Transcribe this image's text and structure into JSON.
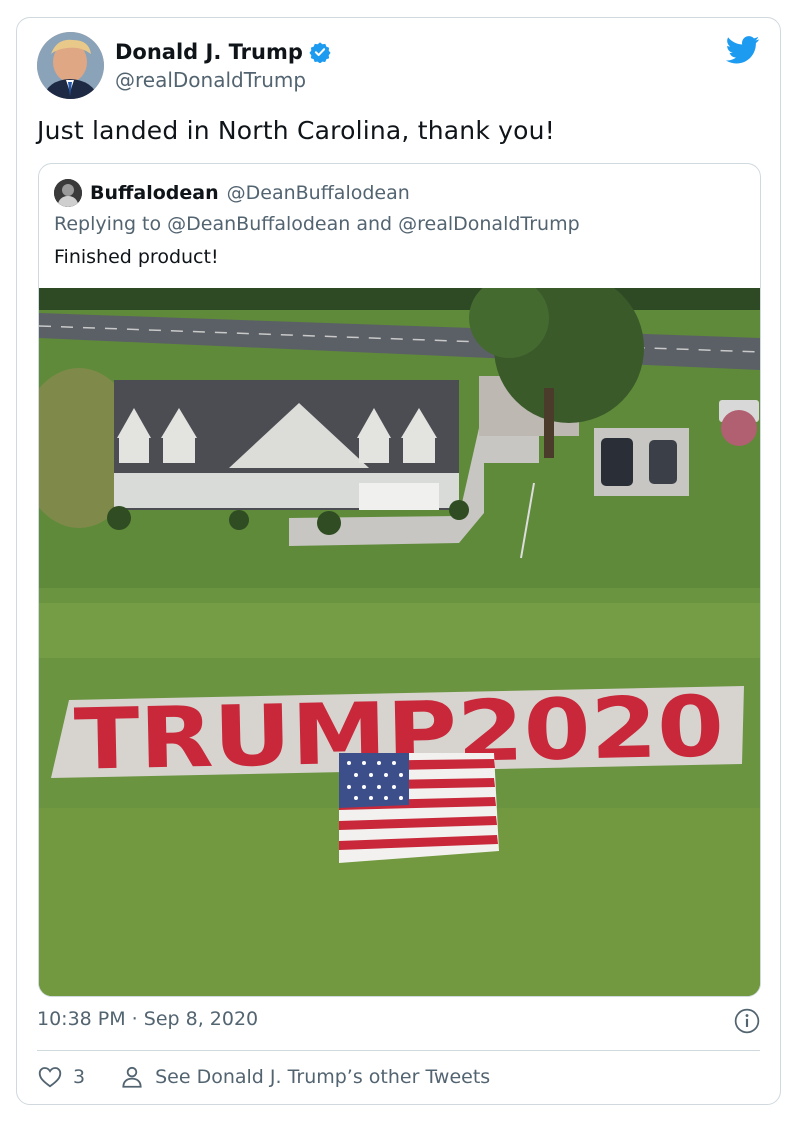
{
  "author": {
    "name": "Donald J. Trump",
    "handle": "@realDonaldTrump",
    "verified": true
  },
  "tweet_text": "Just landed in North Carolina, thank you!",
  "quoted_tweet": {
    "author_name": "Buffalodean",
    "author_handle": "@DeanBuffalodean",
    "reply_line": "Replying to @DeanBuffalodean and @realDonaldTrump",
    "text": "Finished product!",
    "photo": {
      "sign_text": "TRUMP2020",
      "description_icon": "aerial-house-photo"
    }
  },
  "timestamp": "10:38 PM · Sep 8, 2020",
  "actions": {
    "like_count": "3",
    "other_tweets_label": "See Donald J. Trump’s other Tweets"
  },
  "colors": {
    "twitter_blue": "#1d9bf0",
    "secondary_text": "#536471",
    "border": "#cfd9de",
    "grass": "#5f8a3a",
    "sign_red": "#c8283a"
  }
}
